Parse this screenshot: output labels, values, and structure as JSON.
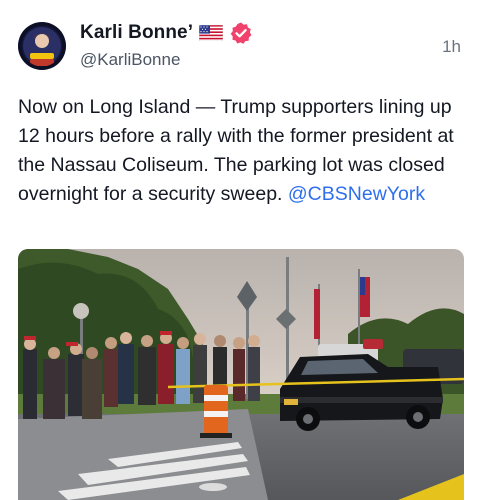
{
  "author": {
    "display_name": "Karli Bonne’",
    "handle": "@KarliBonne",
    "avatar_icon": "profile-avatar",
    "flag_icon": "us-flag-icon",
    "verified_icon": "verified-badge-icon",
    "verified_color": "#f0426c"
  },
  "post": {
    "timestamp": "1h",
    "text": "Now on Long Island — Trump supporters lining up 12 hours before a rally with the former president at the Nassau Coliseum. The parking lot was closed overnight for a security sweep.",
    "mention": "@CBSNewYork",
    "mention_color": "#2f6fed"
  },
  "media": {
    "type": "photo"
  }
}
